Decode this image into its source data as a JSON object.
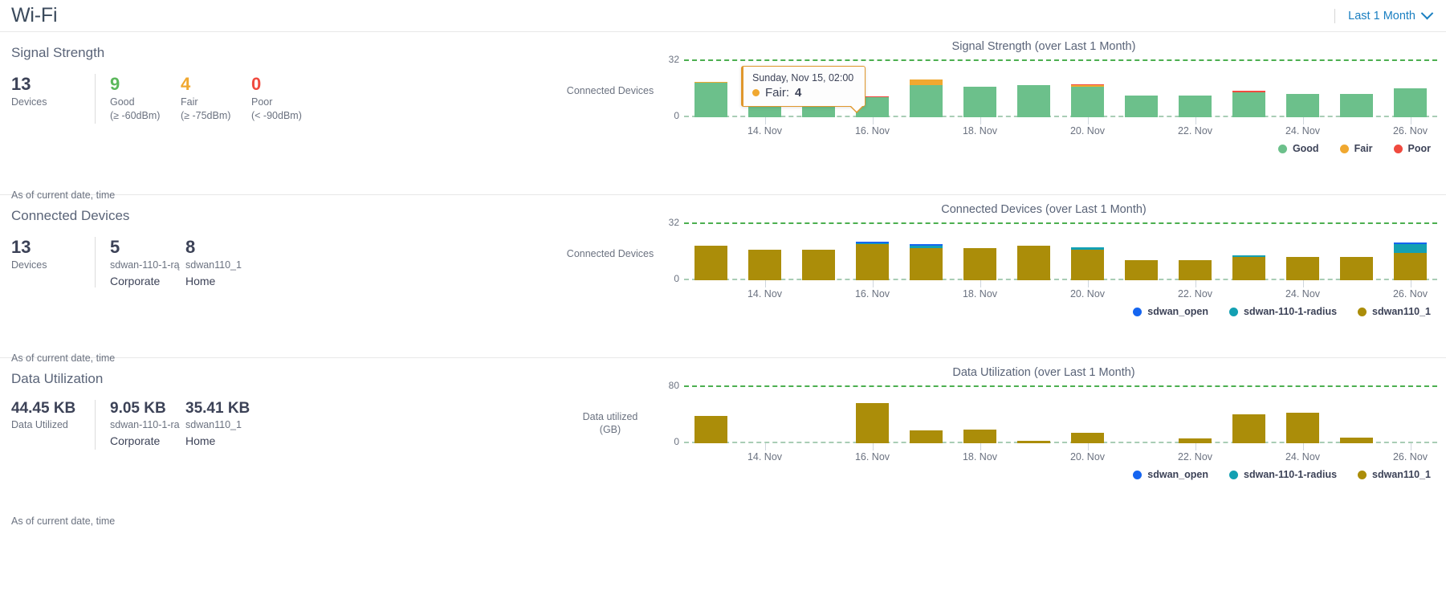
{
  "header": {
    "title": "Wi-Fi",
    "time_range_label": "Last 1 Month",
    "chevron_icon": "chevron-down-icon"
  },
  "colors": {
    "good": "#6cc08b",
    "fair": "#f0a830",
    "poor": "#f04a3f",
    "sdwan_open": "#1565f0",
    "sdwan_radius": "#13a0b2",
    "sdwan110_1": "#ab8d09",
    "accent": "#1a7fc1",
    "grid_top": "#4caf50",
    "grid_bottom": "#a9cdb5"
  },
  "sections": [
    {
      "title": "Signal Strength",
      "asof": "As of current date, time",
      "total": {
        "value": "13",
        "label": "Devices"
      },
      "breakdown": [
        {
          "value": "9",
          "label": "Good",
          "sub": "(≥ -60dBm)",
          "color_key": "good"
        },
        {
          "value": "4",
          "label": "Fair",
          "sub": "(≥ -75dBm)",
          "color_key": "fair"
        },
        {
          "value": "0",
          "label": "Poor",
          "sub": "(< -90dBm)",
          "color_key": "poor"
        }
      ]
    },
    {
      "title": "Connected Devices",
      "asof": "As of current date, time",
      "total": {
        "value": "13",
        "label": "Devices"
      },
      "breakdown": [
        {
          "value": "5",
          "label": "sdwan-110-1-rą",
          "sub": "Corporate"
        },
        {
          "value": "8",
          "label": "sdwan110_1",
          "sub": "Home"
        }
      ]
    },
    {
      "title": "Data Utilization",
      "asof": "As of current date, time",
      "total": {
        "value": "44.45 KB",
        "label": "Data Utilized"
      },
      "breakdown": [
        {
          "value": "9.05 KB",
          "label": "sdwan-110-1-ra",
          "sub": "Corporate"
        },
        {
          "value": "35.41 KB",
          "label": "35.41 KB",
          "sub": "Home",
          "label2": "sdwan110_1"
        }
      ]
    }
  ],
  "tooltip": {
    "title": "Sunday, Nov 15, 02:00",
    "series": "Fair",
    "value": "4",
    "label": "Fair: ",
    "dot_icon": "legend-dot-icon"
  },
  "chart_data": [
    {
      "type": "bar",
      "id": "signal-strength",
      "title": "Signal Strength (over Last 1 Month)",
      "stacked": true,
      "ylabel": "Connected Devices",
      "ylim": [
        0,
        32
      ],
      "yticks": [
        "0",
        "32"
      ],
      "grid": true,
      "legend_position": "bottom-right",
      "xlabel": "",
      "x": [
        "13. Nov",
        "14. Nov",
        "15. Nov",
        "16. Nov",
        "17. Nov",
        "18. Nov",
        "19. Nov",
        "20. Nov",
        "21. Nov",
        "22. Nov",
        "23. Nov",
        "24. Nov",
        "25. Nov",
        "26. Nov"
      ],
      "xticks": [
        "14. Nov",
        "16. Nov",
        "18. Nov",
        "20. Nov",
        "22. Nov",
        "24. Nov",
        "26. Nov"
      ],
      "xtick_index": [
        1,
        3,
        5,
        7,
        9,
        11,
        13
      ],
      "series": [
        {
          "name": "Good",
          "color": "#6cc08b",
          "values": [
            19,
            9,
            8,
            11,
            18,
            17,
            18,
            17,
            12,
            12,
            14,
            13,
            13,
            16
          ]
        },
        {
          "name": "Fair",
          "color": "#f0a830",
          "values": [
            0.6,
            4,
            4,
            0,
            3,
            0,
            0,
            0.8,
            0,
            0,
            0,
            0,
            0,
            0
          ]
        },
        {
          "name": "Poor",
          "color": "#f04a3f",
          "values": [
            0,
            0,
            0.6,
            0.6,
            0,
            0,
            0,
            0.6,
            0,
            0,
            0.6,
            0,
            0,
            0
          ]
        }
      ]
    },
    {
      "type": "bar",
      "id": "connected-devices",
      "title": "Connected Devices (over Last 1 Month)",
      "stacked": true,
      "ylabel": "Connected Devices",
      "ylim": [
        0,
        32
      ],
      "yticks": [
        "0",
        "32"
      ],
      "grid": true,
      "legend_position": "bottom-right",
      "xlabel": "",
      "x": [
        "13. Nov",
        "14. Nov",
        "15. Nov",
        "16. Nov",
        "17. Nov",
        "18. Nov",
        "19. Nov",
        "20. Nov",
        "21. Nov",
        "22. Nov",
        "23. Nov",
        "24. Nov",
        "25. Nov",
        "26. Nov"
      ],
      "xticks": [
        "14. Nov",
        "16. Nov",
        "18. Nov",
        "20. Nov",
        "22. Nov",
        "24. Nov",
        "26. Nov"
      ],
      "xtick_index": [
        1,
        3,
        5,
        7,
        9,
        11,
        13
      ],
      "series": [
        {
          "name": "sdwan110_1",
          "color": "#ab8d09",
          "values": [
            19,
            17,
            17,
            20,
            18,
            18,
            19,
            17,
            11,
            11,
            13,
            13,
            13,
            15
          ]
        },
        {
          "name": "sdwan-110-1-radius",
          "color": "#13a0b2",
          "values": [
            0,
            0,
            0,
            0.6,
            1.2,
            0,
            0,
            1.2,
            0,
            0,
            0.7,
            0,
            0,
            5
          ]
        },
        {
          "name": "sdwan_open",
          "color": "#1565f0",
          "values": [
            0,
            0,
            0,
            0.8,
            0.8,
            0,
            0,
            0,
            0,
            0,
            0,
            0,
            0,
            0.8
          ]
        }
      ]
    },
    {
      "type": "bar",
      "id": "data-utilization",
      "title": "Data Utilization (over Last 1 Month)",
      "stacked": true,
      "ylabel": "Data utilized (GB)",
      "ylim": [
        0,
        80
      ],
      "yticks": [
        "0",
        "80"
      ],
      "grid": true,
      "legend_position": "bottom-right",
      "xlabel": "",
      "x": [
        "13. Nov",
        "14. Nov",
        "15. Nov",
        "16. Nov",
        "17. Nov",
        "18. Nov",
        "19. Nov",
        "20. Nov",
        "21. Nov",
        "22. Nov",
        "23. Nov",
        "24. Nov",
        "25. Nov",
        "26. Nov"
      ],
      "xticks": [
        "14. Nov",
        "16. Nov",
        "18. Nov",
        "20. Nov",
        "22. Nov",
        "24. Nov",
        "26. Nov"
      ],
      "xtick_index": [
        1,
        3,
        5,
        7,
        9,
        11,
        13
      ],
      "series": [
        {
          "name": "sdwan110_1",
          "color": "#ab8d09",
          "values": [
            38,
            0,
            0,
            56,
            18,
            19,
            3,
            14,
            0,
            7,
            40,
            42,
            8,
            0
          ]
        },
        {
          "name": "sdwan-110-1-radius",
          "color": "#13a0b2",
          "values": [
            0,
            0,
            0,
            0,
            0,
            0,
            0,
            0,
            0,
            0,
            0,
            0,
            0,
            0
          ]
        },
        {
          "name": "sdwan_open",
          "color": "#1565f0",
          "values": [
            0,
            0,
            0,
            0,
            0,
            0,
            0,
            0,
            0,
            0,
            0,
            0,
            0,
            0
          ]
        }
      ]
    }
  ]
}
